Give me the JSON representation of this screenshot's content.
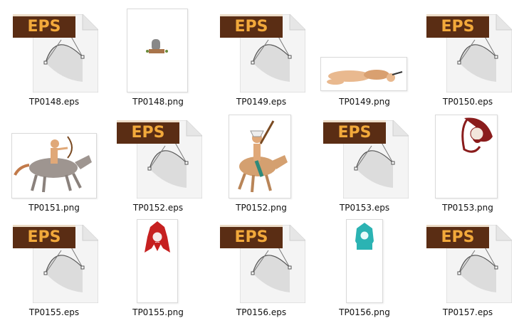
{
  "files": [
    {
      "name": "TP0148.eps",
      "kind": "eps"
    },
    {
      "name": "TP0148.png",
      "kind": "png-tombstone"
    },
    {
      "name": "TP0149.eps",
      "kind": "eps"
    },
    {
      "name": "TP0149.png",
      "kind": "png-lying-figure"
    },
    {
      "name": "TP0150.eps",
      "kind": "eps"
    },
    {
      "name": "TP0151.png",
      "kind": "png-horse-archer"
    },
    {
      "name": "TP0152.eps",
      "kind": "eps"
    },
    {
      "name": "TP0152.png",
      "kind": "png-horse-rider"
    },
    {
      "name": "TP0153.eps",
      "kind": "eps"
    },
    {
      "name": "TP0153.png",
      "kind": "png-chief-head-red"
    },
    {
      "name": "TP0155.eps",
      "kind": "eps"
    },
    {
      "name": "TP0155.png",
      "kind": "png-chief-red"
    },
    {
      "name": "TP0156.eps",
      "kind": "eps"
    },
    {
      "name": "TP0156.png",
      "kind": "png-chief-teal"
    },
    {
      "name": "TP0157.eps",
      "kind": "eps"
    }
  ],
  "eps_badge_label": "EPS",
  "colors": {
    "badge_bg": "#5a2d14",
    "badge_text": "#f2a93b",
    "selection": "#cce8ff"
  }
}
